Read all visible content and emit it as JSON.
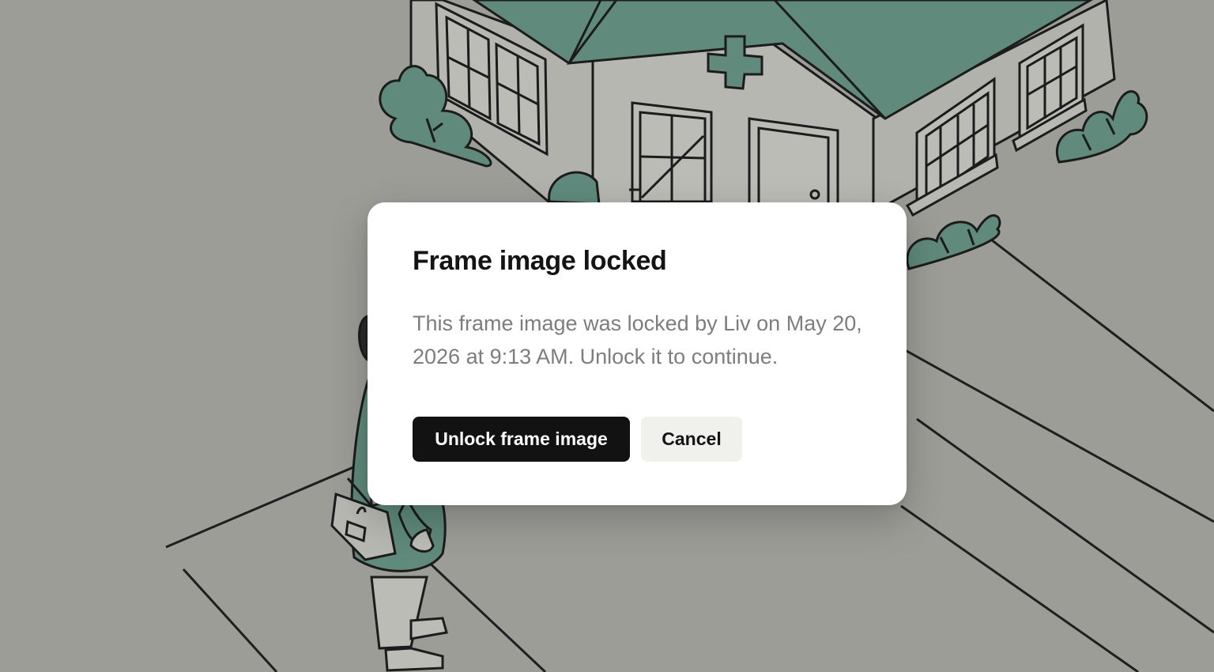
{
  "colors": {
    "backdrop": "#9c9d97",
    "roof": "#5f8a7c",
    "line": "#1c1c1c",
    "wall": "#b4b4ae",
    "primary_button": "#121212",
    "secondary_button": "#f0f0ec"
  },
  "background": {
    "icons": [
      "clinic-building-illustration",
      "person-with-bag-illustration",
      "bush-icon",
      "medical-cross-icon"
    ]
  },
  "dialog": {
    "title": "Frame image locked",
    "message": "This frame image was locked by Liv on May 20, 2026 at 9:13 AM. Unlock it to continue.",
    "primary_action": "Unlock frame image",
    "secondary_action": "Cancel"
  }
}
